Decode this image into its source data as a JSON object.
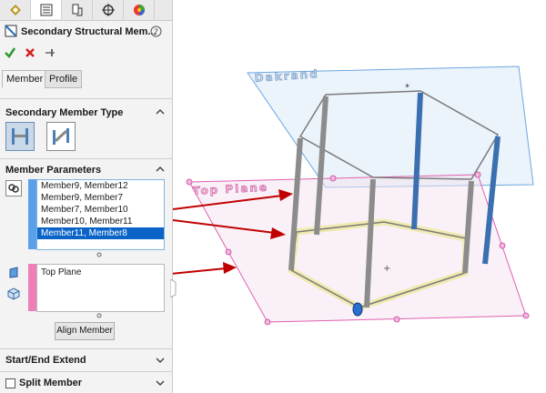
{
  "panel": {
    "title": "Secondary Structural Mem...",
    "tabs": [
      "feature-manager",
      "property-manager",
      "configuration-manager",
      "dimxpert-manager",
      "display-manager"
    ],
    "subtabs": [
      {
        "label": "Member",
        "active": true
      },
      {
        "label": "Profile",
        "active": false
      }
    ],
    "secondary_member_type": {
      "heading": "Secondary Member Type"
    },
    "member_parameters": {
      "heading": "Member Parameters",
      "pairs": [
        "Member9, Member12",
        "Member9, Member7",
        "Member7, Member10",
        "Member10, Member11",
        "Member11, Member8"
      ],
      "selected_index": 4,
      "plane_value": "Top Plane",
      "align_button": "Align Member"
    },
    "start_end_extend": "Start/End Extend",
    "split_member": "Split Member"
  },
  "viewport": {
    "plane_label_1": "Dakrand",
    "plane_label_2": "Top Plane"
  },
  "colors": {
    "accent_blue": "#0a64c8",
    "arrow_red": "#c00000",
    "plane_pink": "#e060b0",
    "plane_blue": "#6ba7e0"
  }
}
